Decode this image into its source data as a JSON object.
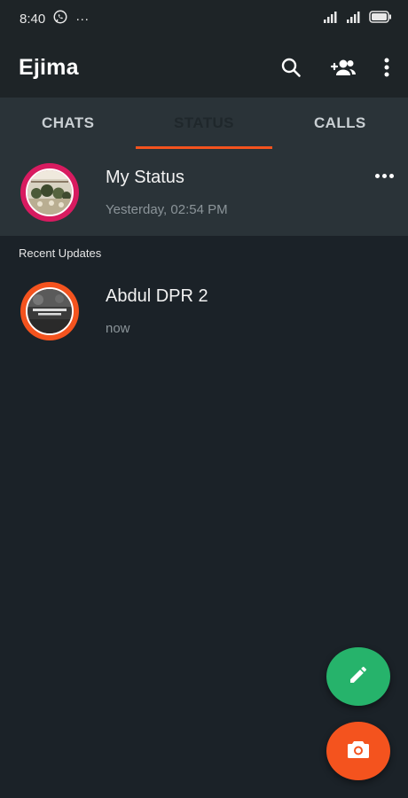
{
  "status_bar": {
    "time": "8:40",
    "extra_icons": "···"
  },
  "app_bar": {
    "title": "Ejima"
  },
  "tabs": [
    {
      "label": "CHATS",
      "active": false
    },
    {
      "label": "STATUS",
      "active": true
    },
    {
      "label": "CALLS",
      "active": false
    }
  ],
  "my_status": {
    "name": "My Status",
    "time": "Yesterday, 02:54 PM"
  },
  "recent_updates": {
    "label": "Recent Updates",
    "items": [
      {
        "name": "Abdul DPR 2",
        "time": "now"
      }
    ]
  },
  "icons": {
    "search": "search-icon",
    "add_contact": "add-contact-icon",
    "menu": "more-vert-icon",
    "edit": "pencil-icon",
    "camera": "camera-icon"
  },
  "colors": {
    "accent": "#f4531e",
    "fab_edit": "#26b36b",
    "background": "#1b2228",
    "panel": "#2a3338",
    "status_ring": "#d81b60"
  }
}
